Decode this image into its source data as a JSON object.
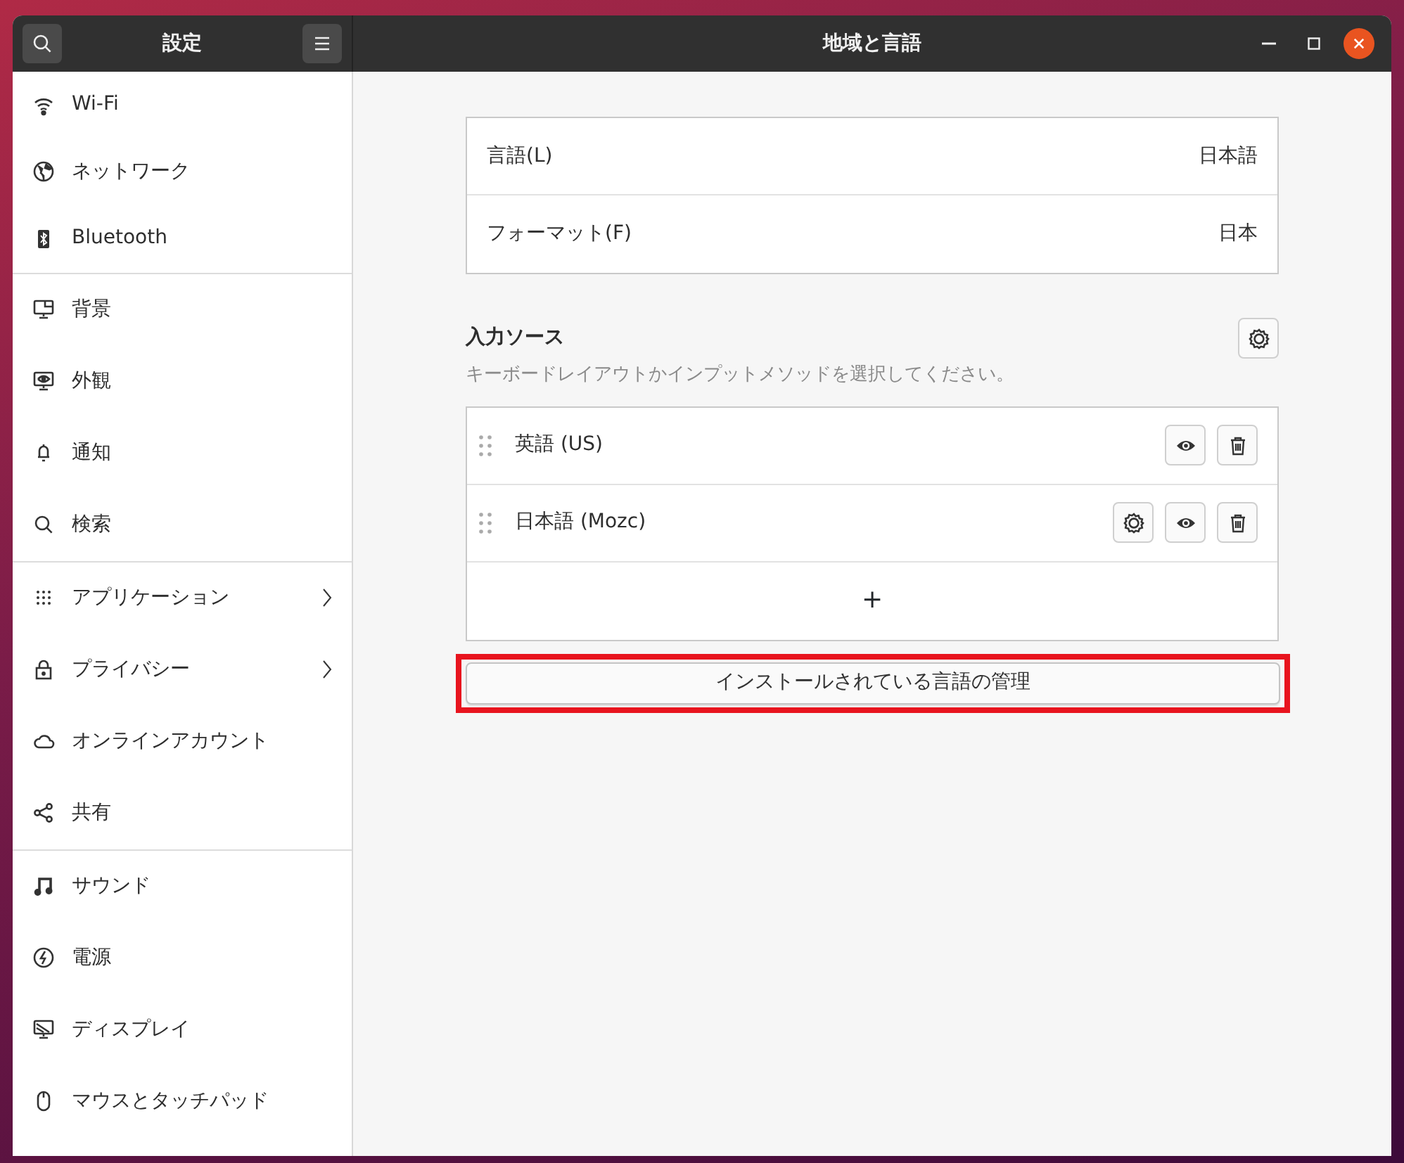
{
  "sidebar": {
    "title": "設定",
    "groups": [
      [
        {
          "label": "Wi-Fi",
          "chevron": false
        },
        {
          "label": "ネットワーク",
          "chevron": false
        },
        {
          "label": "Bluetooth",
          "chevron": false
        }
      ],
      [
        {
          "label": "背景",
          "chevron": false
        },
        {
          "label": "外観",
          "chevron": false
        },
        {
          "label": "通知",
          "chevron": false
        },
        {
          "label": "検索",
          "chevron": false
        }
      ],
      [
        {
          "label": "アプリケーション",
          "chevron": true
        },
        {
          "label": "プライバシー",
          "chevron": true
        },
        {
          "label": "オンラインアカウント",
          "chevron": false
        },
        {
          "label": "共有",
          "chevron": false
        }
      ],
      [
        {
          "label": "サウンド",
          "chevron": false
        },
        {
          "label": "電源",
          "chevron": false
        },
        {
          "label": "ディスプレイ",
          "chevron": false
        },
        {
          "label": "マウスとタッチパッド",
          "chevron": false
        }
      ]
    ]
  },
  "window": {
    "title": "地域と言語"
  },
  "settings": [
    {
      "label": "言語(L)",
      "value": "日本語"
    },
    {
      "label": "フォーマット(F)",
      "value": "日本"
    }
  ],
  "input_sources": {
    "title": "入力ソース",
    "description": "キーボードレイアウトかインプットメソッドを選択してください。",
    "items": [
      {
        "label": "英語 (US)",
        "has_settings": false
      },
      {
        "label": "日本語 (Mozc)",
        "has_settings": true
      }
    ],
    "add": "+"
  },
  "manage_button": {
    "label": "インストールされている言語の管理",
    "highlighted": true
  }
}
